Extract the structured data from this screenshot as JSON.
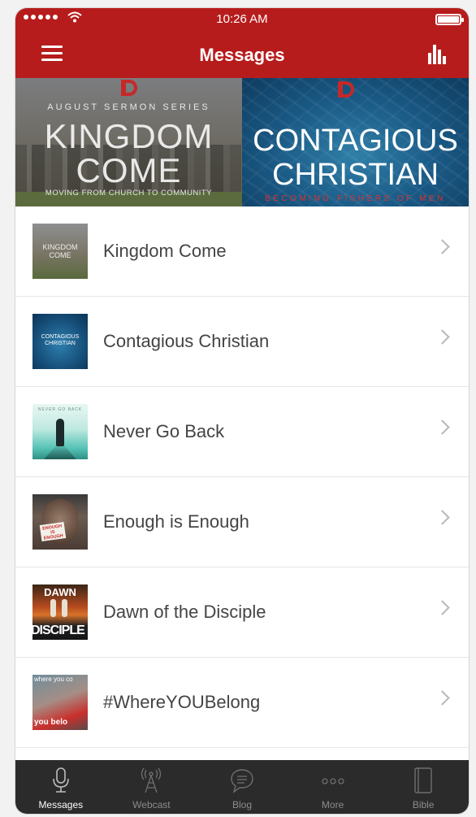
{
  "status_bar": {
    "time": "10:26 AM"
  },
  "nav": {
    "title": "Messages",
    "menu_icon": "hamburger-menu-icon",
    "stats_icon": "bar-chart-icon"
  },
  "banner": {
    "left": {
      "kicker": "AUGUST SERMON SERIES",
      "title_line1": "KINGDOM",
      "title_line2": "COME",
      "subtitle": "MOVING FROM CHURCH TO COMMUNITY"
    },
    "right": {
      "title_line1": "CONTAGIOUS",
      "title_line2": "CHRISTIAN",
      "subtitle": "BECOMING FISHERS OF MEN"
    },
    "accent_color": "#c62828"
  },
  "messages": [
    {
      "title": "Kingdom Come",
      "thumb_text": "KINGDOM COME"
    },
    {
      "title": "Contagious Christian",
      "thumb_text": "CONTAGIOUS CHRISTIAN"
    },
    {
      "title": "Never Go Back",
      "thumb_text": "NEVER GO BACK"
    },
    {
      "title": "Enough is Enough",
      "thumb_text": "ENOUGH IS ENOUGH"
    },
    {
      "title": "Dawn of the Disciple",
      "thumb_top": "DAWN",
      "thumb_bottom": "DISCIPLE"
    },
    {
      "title": "#WhereYOUBelong",
      "thumb_top": "where you co",
      "thumb_bottom": "you belo"
    }
  ],
  "tabs": [
    {
      "label": "Messages",
      "icon": "microphone-icon",
      "active": true
    },
    {
      "label": "Webcast",
      "icon": "broadcast-tower-icon",
      "active": false
    },
    {
      "label": "Blog",
      "icon": "chat-bubble-icon",
      "active": false
    },
    {
      "label": "More",
      "icon": "more-dots-icon",
      "active": false
    },
    {
      "label": "Bible",
      "icon": "book-icon",
      "active": false
    }
  ],
  "colors": {
    "brand_red": "#b71c1c",
    "tabbar_bg": "#2b2b2b"
  }
}
